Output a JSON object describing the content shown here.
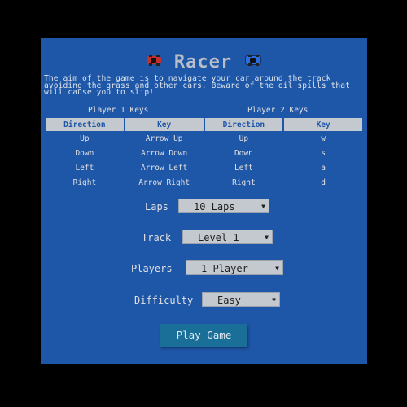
{
  "title": "Racer",
  "intro": "The aim of the game is to navigate your car around the track avoiding the grass and other cars. Beware of the oil spills that will cause you to slip!",
  "keys": {
    "player1_heading": "Player 1 Keys",
    "player2_heading": "Player 2 Keys",
    "headers": [
      "Direction",
      "Key",
      "Direction",
      "Key"
    ],
    "rows": [
      [
        "Up",
        "Arrow Up",
        "Up",
        "w"
      ],
      [
        "Down",
        "Arrow Down",
        "Down",
        "s"
      ],
      [
        "Left",
        "Arrow Left",
        "Left",
        "a"
      ],
      [
        "Right",
        "Arrow Right",
        "Right",
        "d"
      ]
    ]
  },
  "form": {
    "laps": {
      "label": "Laps",
      "value": "10 Laps"
    },
    "track": {
      "label": "Track",
      "value": "Level 1"
    },
    "players": {
      "label": "Players",
      "value": "1 Player"
    },
    "difficulty": {
      "label": "Difficulty",
      "value": "Easy"
    }
  },
  "play_label": "Play Game",
  "icons": {
    "left": "red-car-icon",
    "right": "blue-car-icon"
  },
  "colors": {
    "panel": "#1e56a8",
    "button": "#1a6f99",
    "header_cell": "#c4c9d0"
  }
}
